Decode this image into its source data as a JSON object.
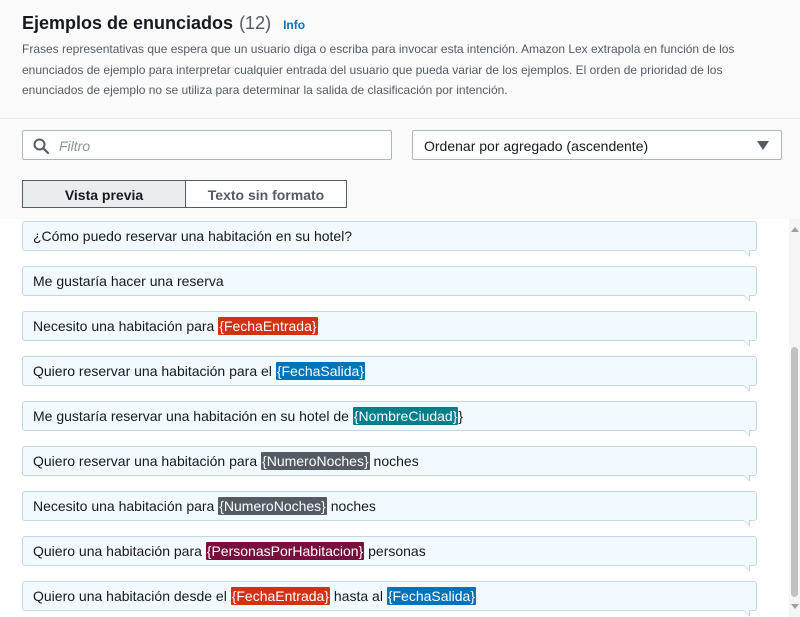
{
  "header": {
    "title": "Ejemplos de enunciados",
    "count": "(12)",
    "info": "Info",
    "description": "Frases representativas que espera que un usuario diga o escriba para invocar esta intención. Amazon Lex extrapola en función de los enunciados de ejemplo para interpretar cualquier entrada del usuario que pueda variar de los ejemplos. El orden de prioridad de los enunciados de ejemplo no se utiliza para determinar la salida de clasificación por intención."
  },
  "filter": {
    "placeholder": "Filtro",
    "icon": "search-icon"
  },
  "sort": {
    "selected": "Ordenar por agregado (ascendente)",
    "icon": "caret-down-icon"
  },
  "tabs": [
    {
      "label": "Vista previa",
      "active": true
    },
    {
      "label": "Texto sin formato",
      "active": false
    }
  ],
  "slot_colors": {
    "FechaEntrada": "#d13212",
    "FechaSalida": "#0073bb",
    "NombreCiudad": "#007e8a",
    "NumeroNoches": "#545b64",
    "PersonasPorHabitacion": "#7a0f3d"
  },
  "utterances": [
    [
      {
        "t": "¿Cómo puedo reservar una habitación en su hotel?"
      }
    ],
    [
      {
        "t": "Me gustaría hacer una reserva"
      }
    ],
    [
      {
        "t": "Necesito una habitación para "
      },
      {
        "s": "{FechaEntrada}",
        "k": "FechaEntrada"
      }
    ],
    [
      {
        "t": "Quiero reservar una habitación para el "
      },
      {
        "s": "{FechaSalida}",
        "k": "FechaSalida"
      }
    ],
    [
      {
        "t": "Me gustaría reservar una habitación en su hotel de "
      },
      {
        "s": "{NombreCiudad}",
        "k": "NombreCiudad"
      },
      {
        "t": "}"
      }
    ],
    [
      {
        "t": "Quiero reservar una habitación para "
      },
      {
        "s": "{NumeroNoches}",
        "k": "NumeroNoches"
      },
      {
        "t": " noches"
      }
    ],
    [
      {
        "t": "Necesito una habitación para "
      },
      {
        "s": "{NumeroNoches}",
        "k": "NumeroNoches"
      },
      {
        "t": "  noches"
      }
    ],
    [
      {
        "t": "Quiero una habitación para "
      },
      {
        "s": "{PersonasPorHabitacion}",
        "k": "PersonasPorHabitacion"
      },
      {
        "t": "  personas"
      }
    ],
    [
      {
        "t": "Quiero una habitación desde el "
      },
      {
        "s": "{FechaEntrada}",
        "k": "FechaEntrada"
      },
      {
        "t": " hasta al "
      },
      {
        "s": "{FechaSalida}",
        "k": "FechaSalida"
      }
    ]
  ]
}
